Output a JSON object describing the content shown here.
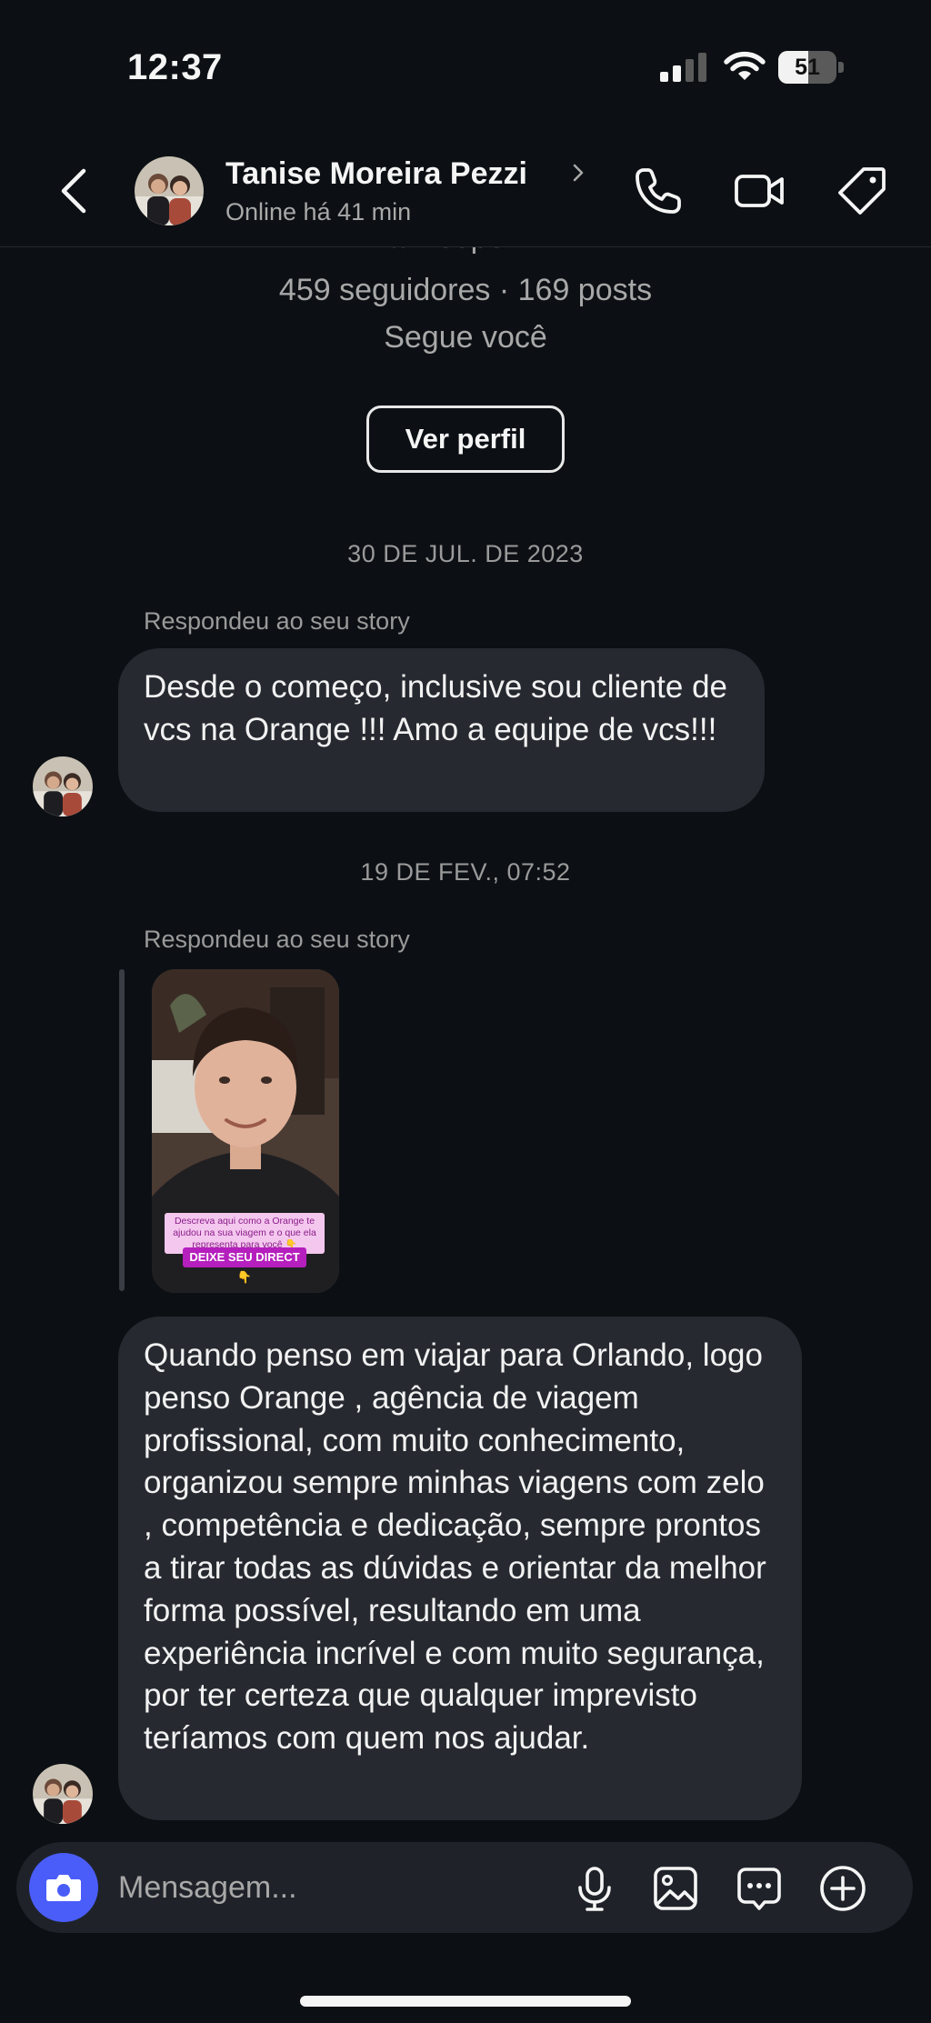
{
  "status_bar": {
    "time": "12:37",
    "battery_level": "51",
    "battery_fraction": 0.51
  },
  "header": {
    "contact_name": "Tanise Moreira Pezzi",
    "contact_status": "Online há 41 min",
    "icons": [
      "back-arrow-icon",
      "phone-icon",
      "video-camera-icon",
      "tag-icon"
    ]
  },
  "profile": {
    "handle_partial": "tanisepezzi",
    "stats": "459 seguidores · 169 posts",
    "follows_you": "Segue você",
    "view_profile_label": "Ver perfil"
  },
  "conversation": {
    "date_1": "30 DE JUL. DE 2023",
    "reply_label_1": "Respondeu ao seu story",
    "message_1": "Desde o começo, inclusive sou cliente de vcs na Orange !!! Amo a equipe de vcs!!!",
    "date_2": "19 DE FEV., 07:52",
    "reply_label_2": "Respondeu ao seu story",
    "story": {
      "caption": "Descreva aqui como a Orange te ajudou na sua viagem e o que ela representa para você 👇",
      "cta": "DEIXE SEU DIRECT 👇"
    },
    "message_2": "Quando penso em viajar para Orlando, logo penso Orange , agência de viagem profissional, com muito conhecimento, organizou sempre minhas viagens com zelo , competência e dedicação, sempre prontos a tirar todas as dúvidas e orientar da melhor forma possível, resultando em uma experiência incrível e com muito segurança, por ter certeza que qualquer imprevisto teríamos com quem nos ajudar."
  },
  "composer": {
    "placeholder": "Mensagem...",
    "icons": [
      "camera-icon",
      "microphone-icon",
      "image-icon",
      "sticker-chat-icon",
      "plus-circle-icon"
    ]
  },
  "colors": {
    "background": "#0c1014",
    "bubble": "#262a30",
    "camera_button": "#4a5df9",
    "secondary_text": "#a8a8a8"
  }
}
